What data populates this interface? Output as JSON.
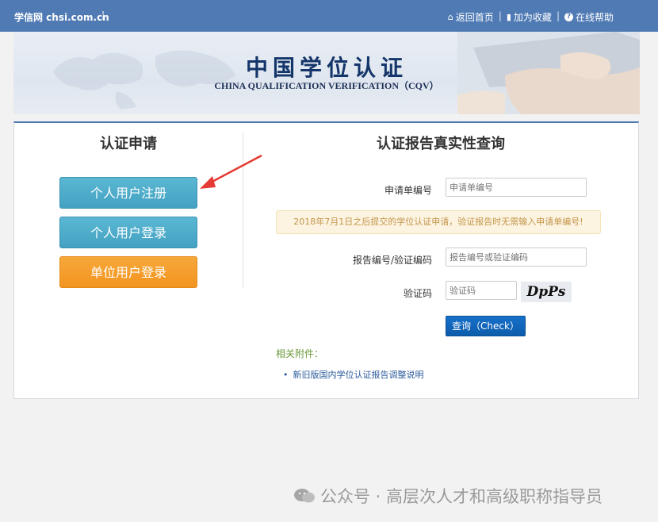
{
  "topbar": {
    "brand": "学信网 chsi.com.cn",
    "brand_sep": "¦",
    "links": [
      {
        "label": "返回首页",
        "icon": "home-icon"
      },
      {
        "label": "加为收藏",
        "icon": "bookmark-icon"
      },
      {
        "label": "在线帮助",
        "icon": "help-icon"
      }
    ],
    "background": "#4f7ab4"
  },
  "banner": {
    "title_cn": "中国学位认证",
    "title_en": "CHINA QUALIFICATION VERIFICATION（CQV）"
  },
  "left": {
    "title": "认证申请",
    "buttons": [
      {
        "label": "个人用户注册",
        "color": "#5bb8d3"
      },
      {
        "label": "个人用户登录",
        "color": "#5bb8d3"
      },
      {
        "label": "单位用户登录",
        "color": "#f7a83b"
      }
    ]
  },
  "right": {
    "title": "认证报告真实性查询",
    "fields": [
      {
        "label": "申请单编号",
        "placeholder": "申请单编号"
      },
      {
        "label": "报告编号/验证编码",
        "placeholder": "报告编号或验证编码"
      },
      {
        "label": "验证码",
        "placeholder": "验证码"
      }
    ],
    "notice": "2018年7月1日之后提交的学位认证申请，验证报告时无需输入申请单编号!",
    "captcha_text": "DpPs",
    "check_button": "查询（Check）",
    "attachments_title": "相关附件：",
    "attachments": [
      "新旧版国内学位认证报告调整说明"
    ]
  },
  "watermark": "公众号 · 高层次人才和高级职称指导员",
  "colors": {
    "accent": "#4f7ab4",
    "arrow": "#e53b35",
    "check": "#1670c9"
  }
}
